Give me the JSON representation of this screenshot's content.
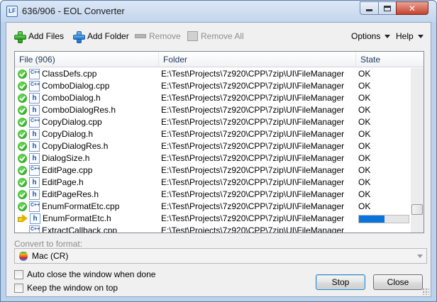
{
  "window": {
    "title": "636/906 - EOL Converter",
    "app_icon": "LF",
    "close_glyph": "✕"
  },
  "toolbar": {
    "add_files": "Add Files",
    "add_folder": "Add Folder",
    "remove": "Remove",
    "remove_all": "Remove All",
    "options": "Options",
    "help": "Help"
  },
  "list": {
    "columns": {
      "file": "File (906)",
      "folder": "Folder",
      "state": "State"
    },
    "rows": [
      {
        "status": "ok",
        "type": "cpp",
        "file": "ClassDefs.cpp",
        "folder": "E:\\Test\\Projects\\7z920\\CPP\\7zip\\UI\\FileManager",
        "state": "OK"
      },
      {
        "status": "ok",
        "type": "cpp",
        "file": "ComboDialog.cpp",
        "folder": "E:\\Test\\Projects\\7z920\\CPP\\7zip\\UI\\FileManager",
        "state": "OK"
      },
      {
        "status": "ok",
        "type": "h",
        "file": "ComboDialog.h",
        "folder": "E:\\Test\\Projects\\7z920\\CPP\\7zip\\UI\\FileManager",
        "state": "OK"
      },
      {
        "status": "ok",
        "type": "h",
        "file": "ComboDialogRes.h",
        "folder": "E:\\Test\\Projects\\7z920\\CPP\\7zip\\UI\\FileManager",
        "state": "OK"
      },
      {
        "status": "ok",
        "type": "cpp",
        "file": "CopyDialog.cpp",
        "folder": "E:\\Test\\Projects\\7z920\\CPP\\7zip\\UI\\FileManager",
        "state": "OK"
      },
      {
        "status": "ok",
        "type": "h",
        "file": "CopyDialog.h",
        "folder": "E:\\Test\\Projects\\7z920\\CPP\\7zip\\UI\\FileManager",
        "state": "OK"
      },
      {
        "status": "ok",
        "type": "h",
        "file": "CopyDialogRes.h",
        "folder": "E:\\Test\\Projects\\7z920\\CPP\\7zip\\UI\\FileManager",
        "state": "OK"
      },
      {
        "status": "ok",
        "type": "h",
        "file": "DialogSize.h",
        "folder": "E:\\Test\\Projects\\7z920\\CPP\\7zip\\UI\\FileManager",
        "state": "OK"
      },
      {
        "status": "ok",
        "type": "cpp",
        "file": "EditPage.cpp",
        "folder": "E:\\Test\\Projects\\7z920\\CPP\\7zip\\UI\\FileManager",
        "state": "OK"
      },
      {
        "status": "ok",
        "type": "h",
        "file": "EditPage.h",
        "folder": "E:\\Test\\Projects\\7z920\\CPP\\7zip\\UI\\FileManager",
        "state": "OK"
      },
      {
        "status": "ok",
        "type": "h",
        "file": "EditPageRes.h",
        "folder": "E:\\Test\\Projects\\7z920\\CPP\\7zip\\UI\\FileManager",
        "state": "OK"
      },
      {
        "status": "ok",
        "type": "cpp",
        "file": "EnumFormatEtc.cpp",
        "folder": "E:\\Test\\Projects\\7z920\\CPP\\7zip\\UI\\FileManager",
        "state": "OK"
      },
      {
        "status": "processing",
        "type": "h",
        "file": "EnumFormatEtc.h",
        "folder": "E:\\Test\\Projects\\7z920\\CPP\\7zip\\UI\\FileManager",
        "state": "",
        "progress": 0.52
      },
      {
        "status": "pending",
        "type": "cpp",
        "file": "ExtractCallback.cpp",
        "folder": "E:\\Test\\Projects\\7z920\\CPP\\7zip\\UI\\FileManager",
        "state": ""
      }
    ],
    "scroll_position": 0.88
  },
  "format": {
    "label": "Convert to format:",
    "selected": "Mac  (CR)"
  },
  "options": {
    "auto_close": "Auto close the window when done",
    "keep_on_top": "Keep the window on top"
  },
  "buttons": {
    "stop": "Stop",
    "close": "Close"
  },
  "colors": {
    "accent": "#0a74da",
    "ok_green": "#1f9616"
  }
}
